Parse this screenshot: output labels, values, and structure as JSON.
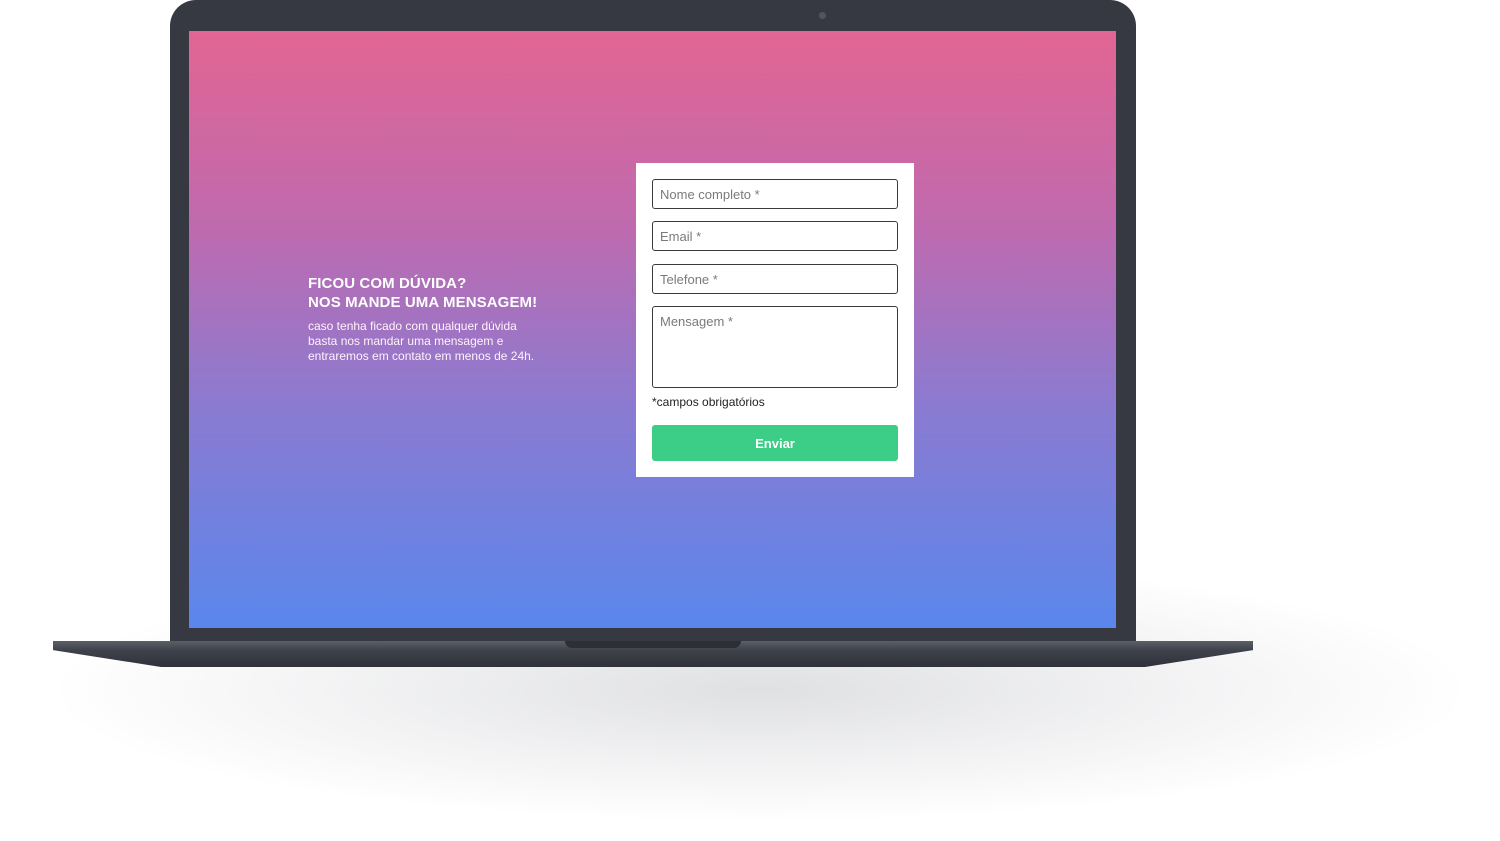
{
  "hero": {
    "headline_line1": "FICOU COM DÚVIDA?",
    "headline_line2": "NOS MANDE UMA MENSAGEM!",
    "body_line1": "caso tenha ficado com qualquer dúvida",
    "body_line2": "basta nos mandar uma mensagem e",
    "body_line3": "entraremos em contato em menos de 24h."
  },
  "form": {
    "name_placeholder": "Nome completo *",
    "email_placeholder": "Email *",
    "phone_placeholder": "Telefone *",
    "message_placeholder": "Mensagem *",
    "required_note": "*campos obrigatórios",
    "submit_label": "Enviar"
  },
  "colors": {
    "gradient_top": "#e26593",
    "gradient_bottom": "#5a87ec",
    "submit_button": "#3ccd86",
    "laptop_frame": "#363941"
  }
}
